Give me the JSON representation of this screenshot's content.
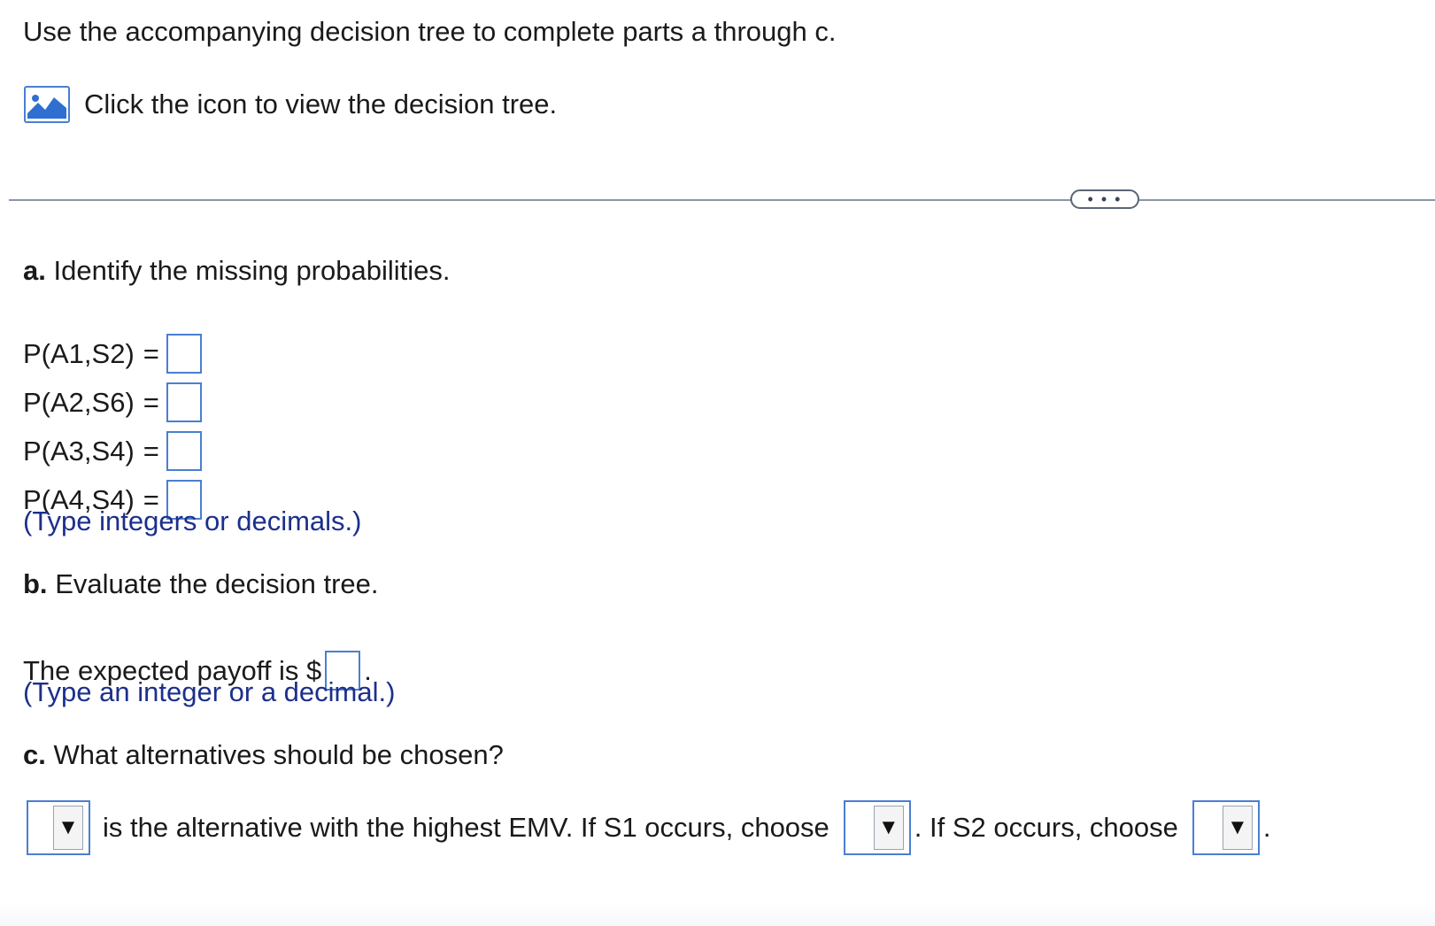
{
  "intro": {
    "text": "Use the accompanying decision tree to complete parts a through c.",
    "icon_text": "Click the icon to view the decision tree.",
    "icon": "image-icon"
  },
  "divider": {
    "more_label": "• • •"
  },
  "part_a": {
    "letter": "a.",
    "prompt": "Identify the missing probabilities.",
    "rows": [
      {
        "label": "P(A1,S2)",
        "eq": "=",
        "value": ""
      },
      {
        "label": "P(A2,S6)",
        "eq": "=",
        "value": ""
      },
      {
        "label": "P(A3,S4)",
        "eq": "=",
        "value": ""
      },
      {
        "label": "P(A4,S4)",
        "eq": "=",
        "value": ""
      }
    ],
    "hint": "(Type integers or decimals.)"
  },
  "part_b": {
    "letter": "b.",
    "prompt": "Evaluate the decision tree.",
    "payoff_prefix": "The expected payoff is $",
    "payoff_suffix": ".",
    "payoff_value": "",
    "hint": "(Type an integer or a decimal.)"
  },
  "part_c": {
    "letter": "c.",
    "prompt": "What alternatives should be chosen?",
    "text_1": "is the alternative with the highest EMV. If S1 occurs, choose",
    "text_2": ". If S2 occurs, choose",
    "text_3": ".",
    "dropdown_arrow": "▼",
    "dropdown_1_value": "",
    "dropdown_2_value": "",
    "dropdown_3_value": ""
  },
  "colors": {
    "input_border": "#4a7fd0",
    "hint_text": "#1c2f8c",
    "divider": "#8a96a8"
  }
}
